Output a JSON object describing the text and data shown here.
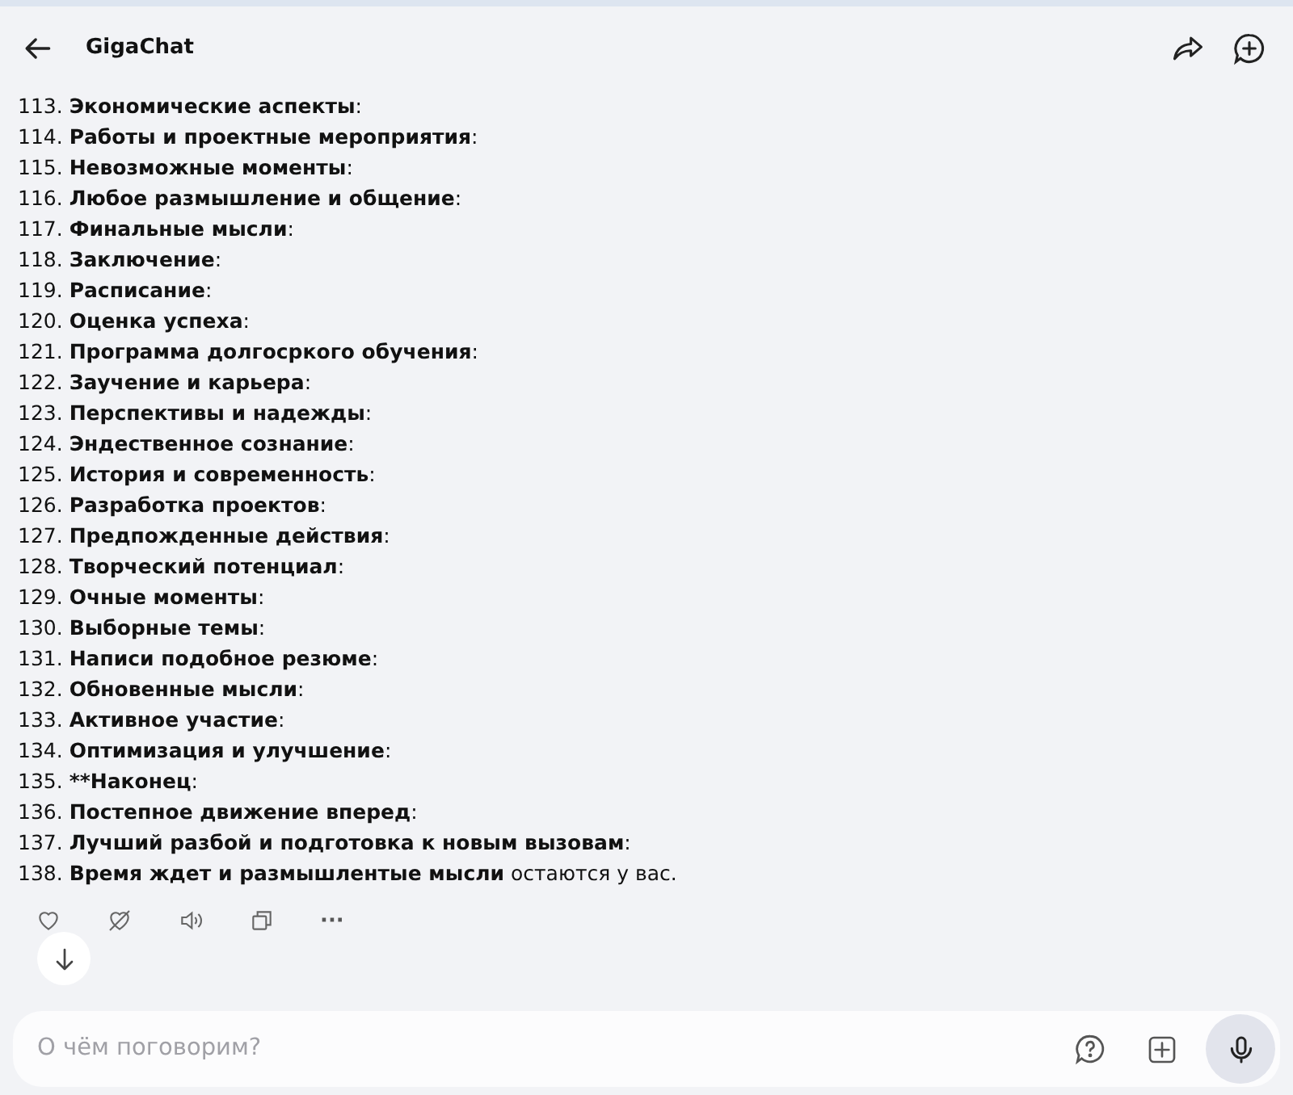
{
  "header": {
    "title": "GigaChat"
  },
  "items": [
    {
      "number": "113.",
      "title": "Экономические аспекты",
      "rest": ":"
    },
    {
      "number": "114.",
      "title": "Работы и проектные мероприятия",
      "rest": ":"
    },
    {
      "number": "115.",
      "title": "Невозможные моменты",
      "rest": ":"
    },
    {
      "number": "116.",
      "title": "Любое размышление и общение",
      "rest": ":"
    },
    {
      "number": "117.",
      "title": "Финальные мысли",
      "rest": ":"
    },
    {
      "number": "118.",
      "title": "Заключение",
      "rest": ":"
    },
    {
      "number": "119.",
      "title": "Расписание",
      "rest": ":"
    },
    {
      "number": "120.",
      "title": "Оценка успеха",
      "rest": ":"
    },
    {
      "number": "121.",
      "title": "Программа долгосркого обучения",
      "rest": ":"
    },
    {
      "number": "122.",
      "title": "Заучение и карьера",
      "rest": ":"
    },
    {
      "number": "123.",
      "title": "Перспективы и надежды",
      "rest": ":"
    },
    {
      "number": "124.",
      "title": "Эндественное сознание",
      "rest": ":"
    },
    {
      "number": "125.",
      "title": "История и современность",
      "rest": ":"
    },
    {
      "number": "126.",
      "title": "Разработка проектов",
      "rest": ":"
    },
    {
      "number": "127.",
      "title": "Предпожденные действия",
      "rest": ":"
    },
    {
      "number": "128.",
      "title": "Творческий потенциал",
      "rest": ":"
    },
    {
      "number": "129.",
      "title": "Очные моменты",
      "rest": ":"
    },
    {
      "number": "130.",
      "title": "Выборные темы",
      "rest": ":"
    },
    {
      "number": "131.",
      "title": "Написи подобное резюме",
      "rest": ":"
    },
    {
      "number": "132.",
      "title": "Обновенные мысли",
      "rest": ":"
    },
    {
      "number": "133.",
      "title": "Активное участие",
      "rest": ":"
    },
    {
      "number": "134.",
      "title": "Оптимизация и улучшение",
      "rest": ":"
    },
    {
      "number": "135.",
      "title": "**Наконец",
      "rest": ":"
    },
    {
      "number": "136.",
      "title": "Постепное движение вперед",
      "rest": ":"
    },
    {
      "number": "137.",
      "title": "Лучший разбой и подготовка к новым вызовам",
      "rest": ":"
    },
    {
      "number": "138.",
      "title": "Время ждет и размышлентые мысли",
      "rest": " остаются у вас."
    }
  ],
  "more_glyph": "···",
  "input": {
    "placeholder": "О чём поговорим?"
  }
}
